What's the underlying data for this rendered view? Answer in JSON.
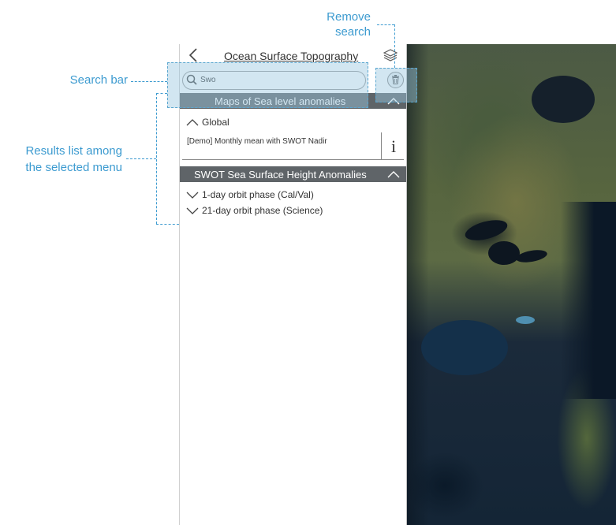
{
  "panel": {
    "title": "Ocean Surface Topography",
    "back_icon": "chevron-left-icon",
    "layers_icon": "layers-icon"
  },
  "search": {
    "value": "Swo",
    "icon": "search-icon",
    "remove_icon": "trash-icon"
  },
  "sections": [
    {
      "title": "Maps of Sea level anomalies",
      "expanded": true,
      "groups": [
        {
          "label": "Global",
          "expanded": true,
          "items": [
            {
              "label": "[Demo] Monthly mean with SWOT Nadir",
              "info_label": "i"
            }
          ]
        }
      ]
    },
    {
      "title": "SWOT Sea Surface Height Anomalies",
      "expanded": true,
      "groups": [
        {
          "label": "1-day orbit phase (Cal/Val)",
          "expanded": false
        },
        {
          "label": "21-day orbit phase (Science)",
          "expanded": false
        }
      ]
    }
  ],
  "annotations": {
    "remove_search": "Remove\nsearch",
    "search_bar": "Search bar",
    "results_list": "Results list among\nthe selected menu"
  },
  "colors": {
    "annotation": "#3d9bd0",
    "section_bar": "#5f6468",
    "highlight": "#9cc8e1"
  }
}
